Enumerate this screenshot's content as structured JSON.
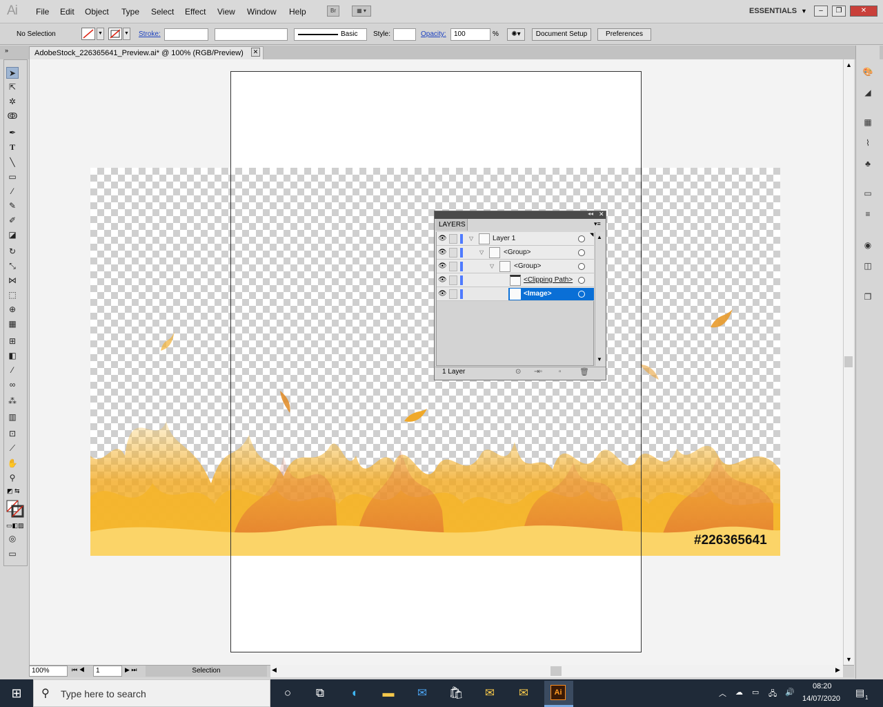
{
  "app": {
    "logo": "Ai",
    "workspace": "ESSENTIALS",
    "bridge_badge": "Br"
  },
  "menu": [
    "File",
    "Edit",
    "Object",
    "Type",
    "Select",
    "Effect",
    "View",
    "Window",
    "Help"
  ],
  "control_bar": {
    "selection_label": "No Selection",
    "stroke_label": "Stroke:",
    "brush_label": "Basic",
    "style_label": "Style:",
    "opacity_label": "Opacity:",
    "opacity_value": "100",
    "opacity_unit": "%",
    "document_setup": "Document Setup",
    "preferences": "Preferences"
  },
  "document": {
    "tab_title": "AdobeStock_226365641_Preview.ai* @ 100% (RGB/Preview)",
    "stock_id": "#226365641"
  },
  "layers_panel": {
    "title": "LAYERS",
    "rows": [
      {
        "name": "Layer 1",
        "indent": 0
      },
      {
        "name": "<Group>",
        "indent": 1
      },
      {
        "name": "<Group>",
        "indent": 2
      },
      {
        "name": "<Clipping Path>",
        "indent": 3
      },
      {
        "name": "<Image>",
        "indent": 3,
        "selected": true
      }
    ],
    "footer": "1 Layer"
  },
  "status_bar": {
    "zoom": "100%",
    "artboard": "1",
    "tool_status": "Selection"
  },
  "taskbar": {
    "search_placeholder": "Type here to search",
    "time": "08:20",
    "date": "14/07/2020",
    "notification_count": "1"
  },
  "colors": {
    "selection_blue": "#0a6fd6",
    "taskbar_bg": "#1f2a38",
    "flame_orange": "#f2a81e"
  }
}
